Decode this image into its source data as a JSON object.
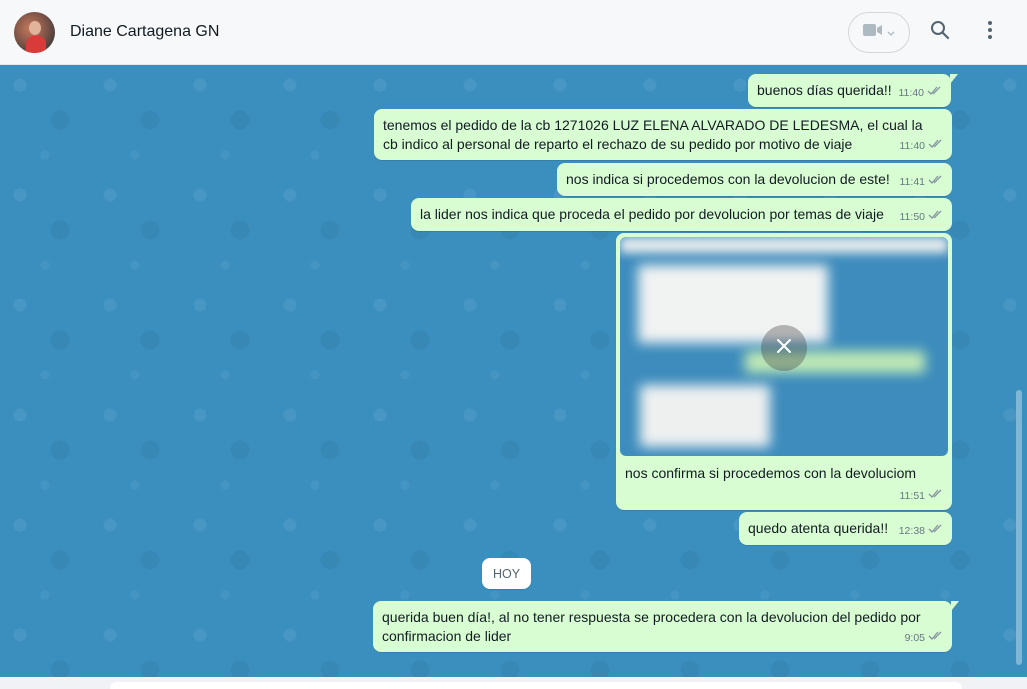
{
  "header": {
    "contact_name": "Diane Cartagena GN",
    "icons": [
      "video-call-icon",
      "chevron-down-icon",
      "search-icon",
      "menu-icon"
    ]
  },
  "messages": [
    {
      "text": "buenos días querida!!",
      "time": "11:40"
    },
    {
      "text": "tenemos el pedido de la cb 1271026 LUZ ELENA ALVARADO DE LEDESMA, el cual la cb indico al personal de reparto el rechazo de su pedido por motivo de viaje",
      "time": "11:40"
    },
    {
      "text": "nos indica si procedemos con la devolucion de este!",
      "time": "11:41"
    },
    {
      "text": "la lider nos indica que proceda el pedido por devolucion por temas de viaje",
      "time": "11:50"
    },
    {
      "text": "nos confirma si procedemos con la devoluciom",
      "time": "11:51",
      "has_image": true
    },
    {
      "text": "quedo atenta querida!!",
      "time": "12:38"
    },
    {
      "text": "querida buen día!, al no tener respuesta se procedera con la devolucion del pedido por confirmacion de lider",
      "time": "9:05"
    }
  ],
  "date_divider": "HOY",
  "colors": {
    "outgoing_bubble": "#d9fdd3",
    "chat_background": "#3b8fbf",
    "header_background": "#f7f8fa"
  }
}
